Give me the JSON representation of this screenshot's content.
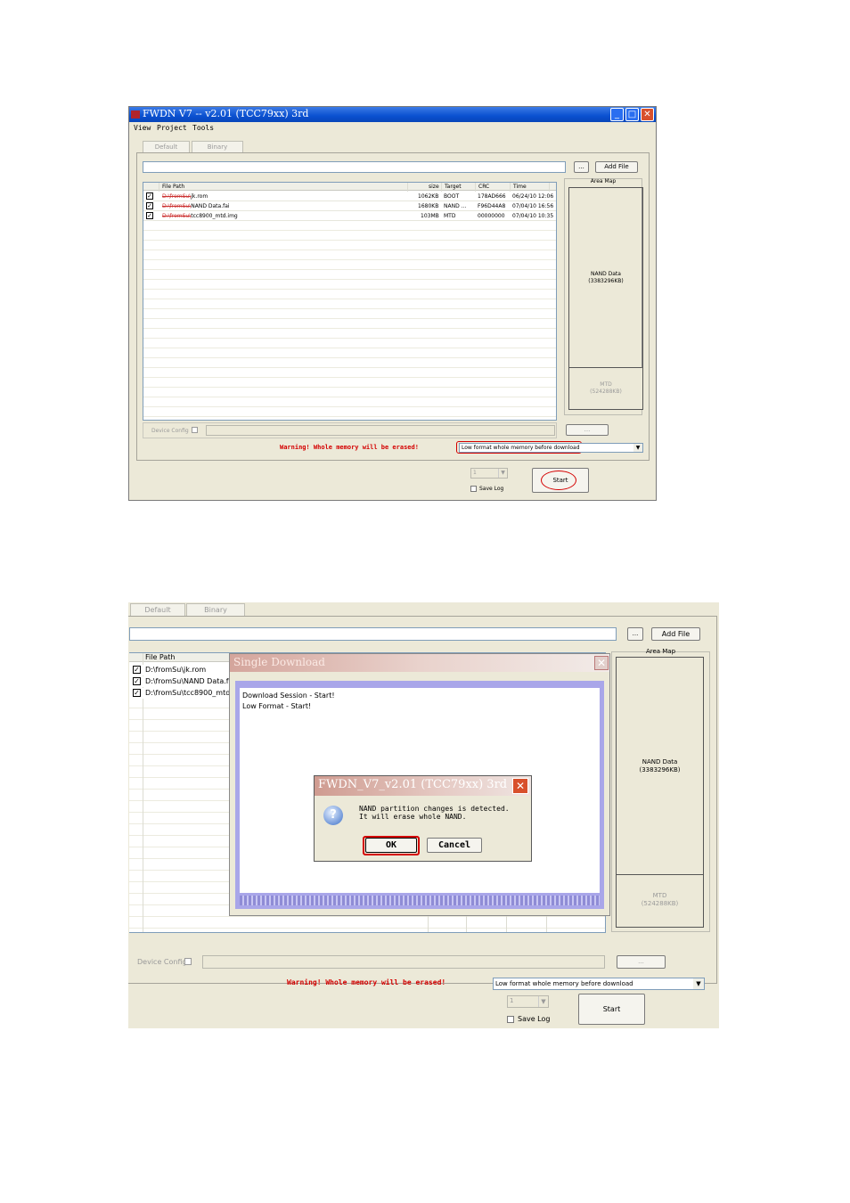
{
  "window1": {
    "title": "FWDN V7 -- v2.01 (TCC79xx) 3rd",
    "menu": [
      "View",
      "Project",
      "Tools"
    ],
    "tabs": [
      "Default",
      "Binary"
    ],
    "add_file_button": "Add File",
    "browse_button": "...",
    "area_map_label": "Area Map",
    "columns": [
      "File Path",
      "size",
      "Target",
      "CRC",
      "Time"
    ],
    "files": [
      {
        "checked": true,
        "path_prefix": "D:\\fromSu\\",
        "path_name": "jk.rom",
        "size": "1062KB",
        "target": "BOOT",
        "crc": "178AD666",
        "time": "06/24/10 12:06"
      },
      {
        "checked": true,
        "path_prefix": "D:\\fromSu\\",
        "path_name": "NAND Data.fai",
        "size": "1680KB",
        "target": "NAND ...",
        "crc": "F96D44A8",
        "time": "07/04/10 16:56"
      },
      {
        "checked": true,
        "path_prefix": "D:\\fromSu\\",
        "path_name": "tcc8900_mtd.img",
        "size": "103MB",
        "target": "MTD",
        "crc": "00000000",
        "time": "07/04/10 10:35"
      }
    ],
    "area_map": {
      "nand_label": "NAND Data",
      "nand_size": "(3383296KB)",
      "mtd_label": "MTD",
      "mtd_size": "(524288KB)"
    },
    "device_config_label": "Device Config",
    "device_config_button": "...",
    "warning": "Warning! Whole memory will be erased!",
    "format_option": "Low format whole memory before download",
    "count_value": "1",
    "save_log_label": "Save Log",
    "start_button": "Start"
  },
  "window2": {
    "tabs": [
      "Default",
      "Binary"
    ],
    "add_file_button": "Add File",
    "browse_button": "...",
    "area_map_label": "Area Map",
    "column_file_path": "File Path",
    "files": [
      "D:\\fromSu\\jk.rom",
      "D:\\fromSu\\NAND Data.fai",
      "D:\\fromSu\\tcc8900_mtd.im"
    ],
    "area_map": {
      "nand_label": "NAND Data",
      "nand_size": "(3383296KB)",
      "mtd_label": "MTD",
      "mtd_size": "(524288KB)"
    },
    "device_config_label": "Device Config",
    "device_config_button": "...",
    "warning": "Warning! Whole memory will be erased!",
    "format_option": "Low format whole memory before download",
    "count_value": "1",
    "save_log_label": "Save Log",
    "start_button": "Start",
    "download_dialog": {
      "title": "Single Download",
      "log_lines": [
        "Download Session - Start!",
        "Low Format - Start!"
      ]
    },
    "confirm_dialog": {
      "title": "FWDN_V7_v2.01 (TCC79xx) 3rd",
      "message_line1": "NAND partition changes is detected.",
      "message_line2": "It will erase whole NAND.",
      "ok_button": "OK",
      "cancel_button": "Cancel"
    }
  },
  "colors": {
    "titlebar_blue": "#0a50d0",
    "dialog_title": "#cf9b90",
    "warning_red": "#d40000",
    "panel_beige": "#ece9d8",
    "progress_purple": "#8f8cd6"
  }
}
